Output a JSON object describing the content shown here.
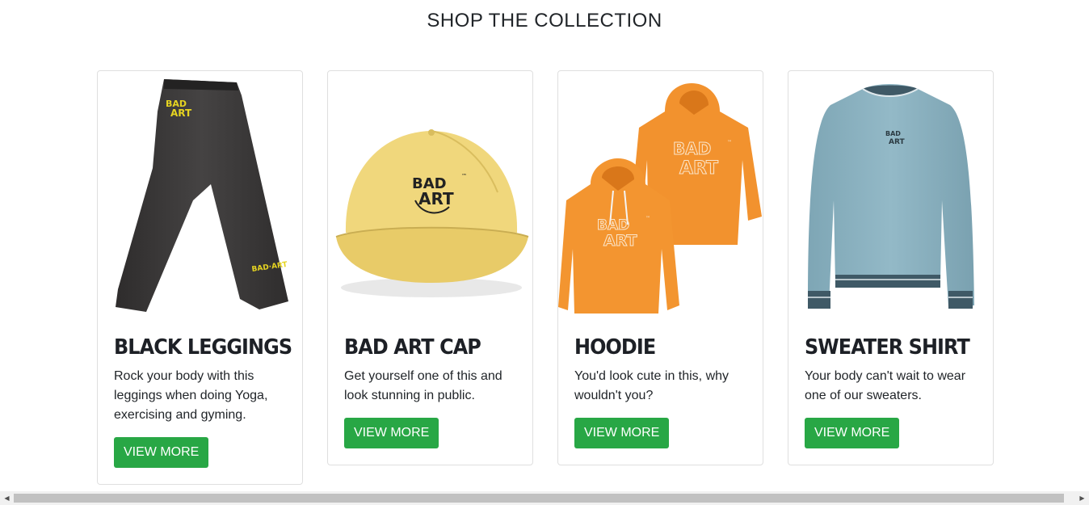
{
  "section": {
    "title": "SHOP THE COLLECTION"
  },
  "products": [
    {
      "title": "BLACK LEGGINGS",
      "description": "Rock your body with this leggings when doing Yoga, exercising and gyming.",
      "button": "VIEW MORE"
    },
    {
      "title": "BAD ART CAP",
      "description": "Get yourself one of this and look stunning in public.",
      "button": "VIEW MORE"
    },
    {
      "title": "HOODIE",
      "description": "You'd look cute in this, why wouldn't you?",
      "button": "VIEW MORE"
    },
    {
      "title": "SWEATER SHIRT",
      "description": "Your body can't wait to wear one of our sweaters.",
      "button": "VIEW MORE"
    }
  ],
  "logo_text": {
    "bad": "BAD",
    "art": "ART",
    "tm": "™",
    "short": "BAD·ART"
  },
  "colors": {
    "button": "#28a745",
    "title": "#1d2026",
    "leggings": "#3a3838",
    "cap": "#f0d77c",
    "hoodie": "#f2922e",
    "sweater": "#87aebd"
  },
  "icons": {
    "scroll_left": "scroll-left-arrow-icon",
    "scroll_right": "scroll-right-arrow-icon"
  }
}
